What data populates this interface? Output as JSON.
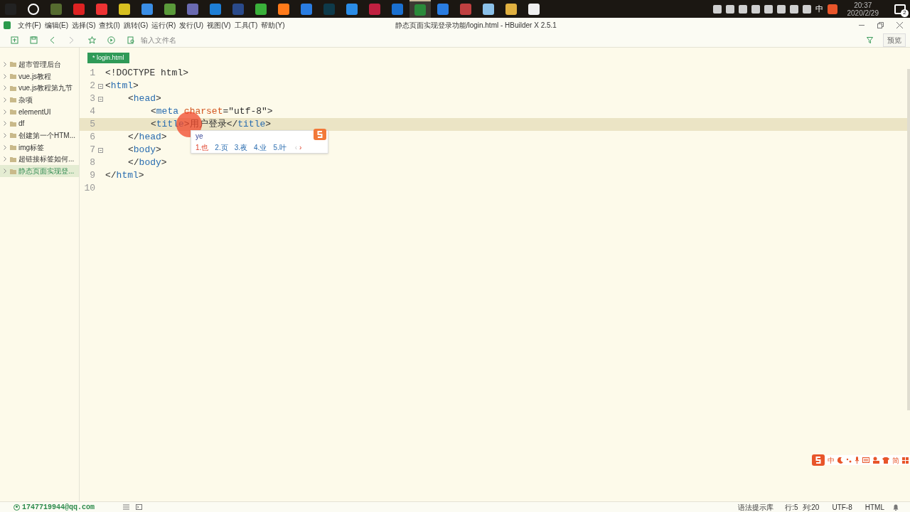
{
  "taskbar": {
    "apps": [
      {
        "selected": false
      },
      {
        "selected": false
      },
      {
        "selected": false
      },
      {
        "selected": false
      },
      {
        "selected": false
      },
      {
        "selected": false
      },
      {
        "selected": false
      },
      {
        "selected": false
      },
      {
        "selected": false
      },
      {
        "selected": false
      },
      {
        "selected": false
      },
      {
        "selected": false
      },
      {
        "selected": false
      },
      {
        "selected": false
      },
      {
        "selected": false
      },
      {
        "selected": false
      },
      {
        "selected": false
      },
      {
        "selected": false
      },
      {
        "selected": true
      },
      {
        "selected": false
      },
      {
        "selected": false
      },
      {
        "selected": false
      },
      {
        "selected": false
      },
      {
        "selected": false
      }
    ],
    "ime": "中",
    "time": "20:37",
    "date": "2020/2/29",
    "notifications": "2"
  },
  "menu": [
    "文件(F)",
    "编辑(E)",
    "选择(S)",
    "查找(I)",
    "跳转(G)",
    "运行(R)",
    "发行(U)",
    "视图(V)",
    "工具(T)",
    "帮助(Y)"
  ],
  "window": {
    "title": "静态页面实现登录功能/login.html - HBuilder X 2.5.1"
  },
  "toolbar": {
    "placeholder": "输入文件名",
    "preview": "预览"
  },
  "sidebar": {
    "items": [
      {
        "label": "超市管理后台",
        "selected": false
      },
      {
        "label": "vue.js教程",
        "selected": false
      },
      {
        "label": "vue.js教程第九节",
        "selected": false
      },
      {
        "label": "杂项",
        "selected": false
      },
      {
        "label": "elementUI",
        "selected": false
      },
      {
        "label": "df",
        "selected": false
      },
      {
        "label": "创建第一个HTM...",
        "selected": false
      },
      {
        "label": "img标签",
        "selected": false
      },
      {
        "label": "超链接标签如何...",
        "selected": false
      },
      {
        "label": "静态页面实现登...",
        "selected": true
      }
    ]
  },
  "tab": {
    "label": "* login.html",
    "selected": true
  },
  "editor": {
    "lines": [
      {
        "number": "1",
        "fold": false,
        "current": false,
        "tokens": [
          {
            "kind": "punct",
            "text": "<!DOCTYPE html>"
          }
        ]
      },
      {
        "number": "2",
        "fold": true,
        "current": false,
        "tokens": [
          {
            "kind": "punct",
            "text": "<"
          },
          {
            "kind": "tag",
            "text": "html"
          },
          {
            "kind": "punct",
            "text": ">"
          }
        ],
        "children": [
          {
            "number": "3",
            "fold": true,
            "current": false,
            "tokens": [
              {
                "kind": "punct",
                "text": "<"
              },
              {
                "kind": "tag",
                "text": "head"
              },
              {
                "kind": "punct",
                "text": ">"
              }
            ],
            "children": [
              {
                "number": "4",
                "fold": false,
                "current": false,
                "tokens": [
                  {
                    "kind": "punct",
                    "text": "<"
                  },
                  {
                    "kind": "tag",
                    "text": "meta "
                  },
                  {
                    "kind": "attr",
                    "text": "charset"
                  },
                  {
                    "kind": "punct",
                    "text": "="
                  },
                  {
                    "kind": "string",
                    "text": "\"utf-8\""
                  },
                  {
                    "kind": "punct",
                    "text": ">"
                  }
                ]
              },
              {
                "number": "5",
                "fold": false,
                "current": true,
                "tokens": [
                  {
                    "kind": "punct",
                    "text": "<"
                  },
                  {
                    "kind": "tag",
                    "text": "title"
                  },
                  {
                    "kind": "punct",
                    "text": ">"
                  },
                  {
                    "kind": "text",
                    "text": "用户登录"
                  },
                  {
                    "kind": "punct",
                    "text": "</"
                  },
                  {
                    "kind": "tag",
                    "text": "title"
                  },
                  {
                    "kind": "punct",
                    "text": ">"
                  }
                ]
              }
            ]
          },
          {
            "number": "6",
            "fold": false,
            "current": false,
            "tokens": [
              {
                "kind": "punct",
                "text": "</"
              },
              {
                "kind": "tag",
                "text": "head"
              },
              {
                "kind": "punct",
                "text": ">"
              }
            ]
          },
          {
            "number": "7",
            "fold": true,
            "current": false,
            "tokens": [
              {
                "kind": "punct",
                "text": "<"
              },
              {
                "kind": "tag",
                "text": "body"
              },
              {
                "kind": "punct",
                "text": ">"
              }
            ]
          },
          {
            "number": "8",
            "fold": false,
            "current": false,
            "tokens": [
              {
                "kind": "punct",
                "text": "</"
              },
              {
                "kind": "tag",
                "text": "body"
              },
              {
                "kind": "punct",
                "text": ">"
              }
            ]
          }
        ]
      },
      {
        "number": "9",
        "fold": false,
        "current": false,
        "tokens": [
          {
            "kind": "punct",
            "text": "</"
          },
          {
            "kind": "tag",
            "text": "html"
          },
          {
            "kind": "punct",
            "text": ">"
          }
        ]
      },
      {
        "number": "10",
        "fold": false,
        "current": false
      }
    ]
  },
  "ime_popup": {
    "input": "ye",
    "candidates": [
      {
        "label": "1.也",
        "selected": true
      },
      {
        "label": "2.页",
        "selected": false
      },
      {
        "label": "3.夜",
        "selected": false
      },
      {
        "label": "4.业",
        "selected": false
      },
      {
        "label": "5.叶",
        "selected": false
      }
    ],
    "prev": "‹",
    "next": "›"
  },
  "ime_bar": {
    "mode": "中",
    "script": "简"
  },
  "status_bar": {
    "account": "1747719944@qq.com",
    "hints": "语法提示库",
    "row": "行:5",
    "col": "列:20",
    "encoding": "UTF-8",
    "language": "HTML"
  }
}
